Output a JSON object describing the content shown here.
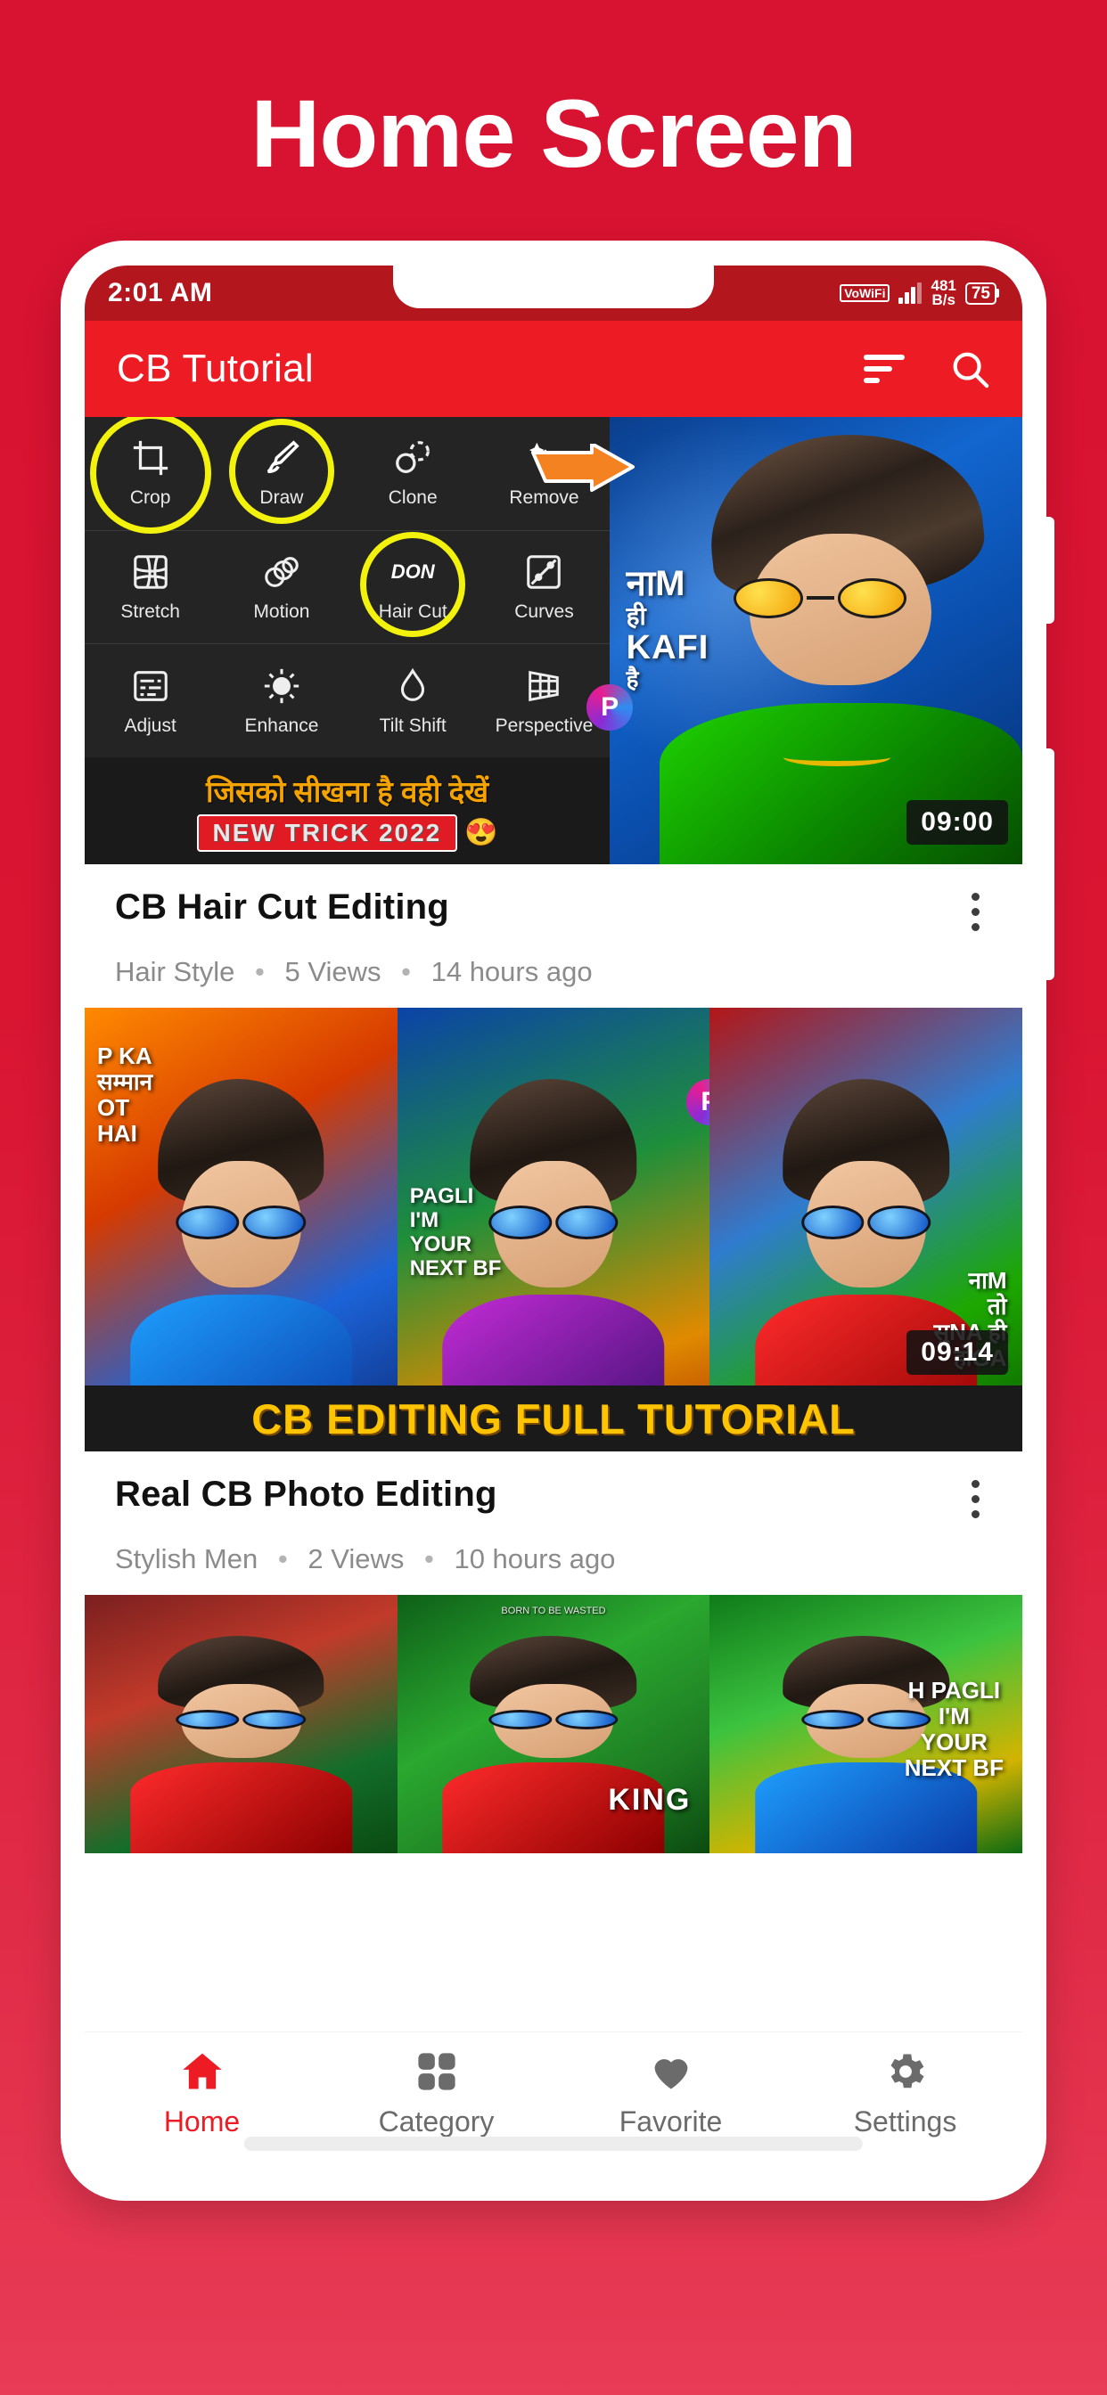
{
  "headline": "Home Screen",
  "theme": {
    "brand_red": "#ed1c24",
    "bg_red": "#d81231",
    "accent_yellow": "#f2f20d"
  },
  "status_bar": {
    "time": "2:01 AM",
    "vowifi_label": "VoWiFi",
    "net_speed_value": "481",
    "net_speed_unit": "B/s",
    "battery_level": "75"
  },
  "app_bar": {
    "title": "CB Tutorial",
    "sort_icon": "sort-icon",
    "search_icon": "search-icon"
  },
  "thumb1": {
    "tools": [
      {
        "label": "Crop",
        "icon": "crop-icon",
        "highlighted": false
      },
      {
        "label": "Draw",
        "icon": "brush-icon",
        "highlighted": true
      },
      {
        "label": "Clone",
        "icon": "clone-icon",
        "highlighted": false
      },
      {
        "label": "Remove",
        "icon": "eraser-icon",
        "highlighted": false
      },
      {
        "label": "Stretch",
        "icon": "stretch-grid-icon",
        "highlighted": false
      },
      {
        "label": "Motion",
        "icon": "motion-icon",
        "highlighted": false
      },
      {
        "label": "Hair Cut",
        "icon": "haircut-icon",
        "highlighted": true
      },
      {
        "label": "Curves",
        "icon": "curves-icon",
        "highlighted": false
      },
      {
        "label": "Adjust",
        "icon": "adjust-icon",
        "highlighted": false
      },
      {
        "label": "Enhance",
        "icon": "enhance-icon",
        "highlighted": false
      },
      {
        "label": "Tilt Shift",
        "icon": "droplet-icon",
        "highlighted": false
      },
      {
        "label": "Perspective",
        "icon": "perspective-icon",
        "highlighted": false
      }
    ],
    "hindi_line": "जिसको सीखना है वही देखें",
    "trick_badge": "NEW TRICK 2022",
    "trick_emoji": "😍",
    "overlay_l1": "नाM",
    "overlay_l2": "ही",
    "overlay_l3": "KAFI",
    "overlay_l4": "है",
    "ps_badge": "P",
    "arrow_icon": "orange-arrow-icon",
    "duration": "09:00"
  },
  "video1": {
    "title": "CB Hair Cut Editing",
    "category": "Hair Style",
    "views": "5 Views",
    "time_ago": "14 hours ago",
    "menu_icon": "kebab-menu-icon"
  },
  "thumb2": {
    "panel_a_text": "P KA\nसम्मान\nOT\nHAI",
    "panel_b_text": "PAGLI\nI'M\nYOUR\nNEXT BF",
    "panel_c_text": "नाM\nतो\nसुNA ही\nहोGA",
    "banner": "CB EDITING FULL TUTORIAL",
    "ps_badge": "P",
    "duration": "09:14"
  },
  "video2": {
    "title": "Real CB Photo Editing",
    "category": "Stylish Men",
    "views": "2 Views",
    "time_ago": "10 hours ago",
    "menu_icon": "kebab-menu-icon"
  },
  "thumb3": {
    "panel_b_tiny": "BORN TO BE WASTED",
    "panel_b_text": "KING",
    "panel_c_text": "H PAGLI\nI'M\nYOUR\nNEXT BF"
  },
  "bottom_nav": [
    {
      "label": "Home",
      "icon": "home-icon",
      "active": true
    },
    {
      "label": "Category",
      "icon": "grid-icon",
      "active": false
    },
    {
      "label": "Favorite",
      "icon": "heart-icon",
      "active": false
    },
    {
      "label": "Settings",
      "icon": "gear-icon",
      "active": false
    }
  ]
}
